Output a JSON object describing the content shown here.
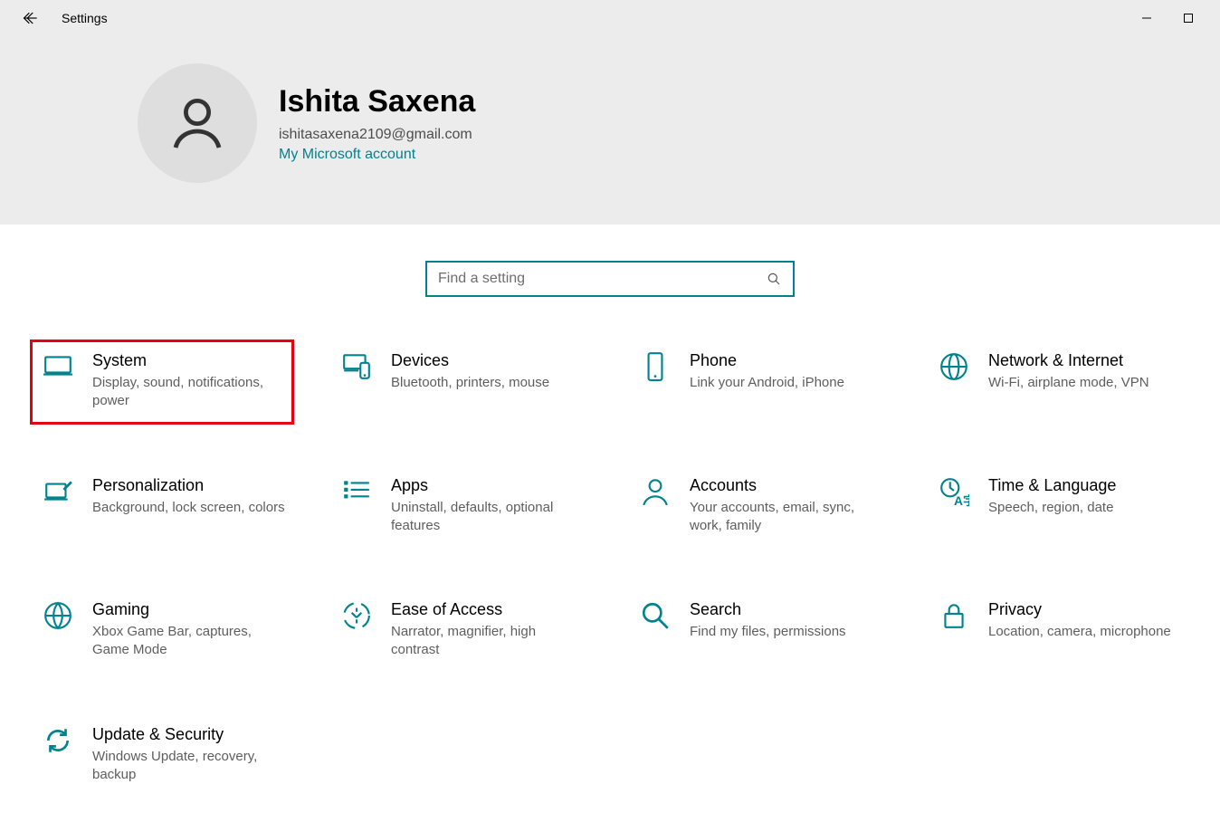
{
  "titlebar": {
    "title": "Settings"
  },
  "user": {
    "name": "Ishita Saxena",
    "email": "ishitasaxena2109@gmail.com",
    "account_link": "My Microsoft account"
  },
  "search": {
    "placeholder": "Find a setting"
  },
  "categories": [
    {
      "id": "system",
      "icon": "monitor",
      "title": "System",
      "desc": "Display, sound, notifications, power",
      "highlight": true
    },
    {
      "id": "devices",
      "icon": "devices",
      "title": "Devices",
      "desc": "Bluetooth, printers, mouse",
      "highlight": false
    },
    {
      "id": "phone",
      "icon": "phone",
      "title": "Phone",
      "desc": "Link your Android, iPhone",
      "highlight": false
    },
    {
      "id": "network",
      "icon": "globe",
      "title": "Network & Internet",
      "desc": "Wi-Fi, airplane mode, VPN",
      "highlight": false
    },
    {
      "id": "personalization",
      "icon": "brush",
      "title": "Personalization",
      "desc": "Background, lock screen, colors",
      "highlight": false
    },
    {
      "id": "apps",
      "icon": "apps",
      "title": "Apps",
      "desc": "Uninstall, defaults, optional features",
      "highlight": false
    },
    {
      "id": "accounts",
      "icon": "person",
      "title": "Accounts",
      "desc": "Your accounts, email, sync, work, family",
      "highlight": false
    },
    {
      "id": "time-language",
      "icon": "timelang",
      "title": "Time & Language",
      "desc": "Speech, region, date",
      "highlight": false
    },
    {
      "id": "gaming",
      "icon": "gaming",
      "title": "Gaming",
      "desc": "Xbox Game Bar, captures, Game Mode",
      "highlight": false
    },
    {
      "id": "ease-of-access",
      "icon": "ease",
      "title": "Ease of Access",
      "desc": "Narrator, magnifier, high contrast",
      "highlight": false
    },
    {
      "id": "search",
      "icon": "search",
      "title": "Search",
      "desc": "Find my files, permissions",
      "highlight": false
    },
    {
      "id": "privacy",
      "icon": "lock",
      "title": "Privacy",
      "desc": "Location, camera, microphone",
      "highlight": false
    },
    {
      "id": "update-security",
      "icon": "update",
      "title": "Update & Security",
      "desc": "Windows Update, recovery, backup",
      "highlight": false
    }
  ],
  "colors": {
    "accent": "#00838f",
    "highlight": "#e60012"
  }
}
